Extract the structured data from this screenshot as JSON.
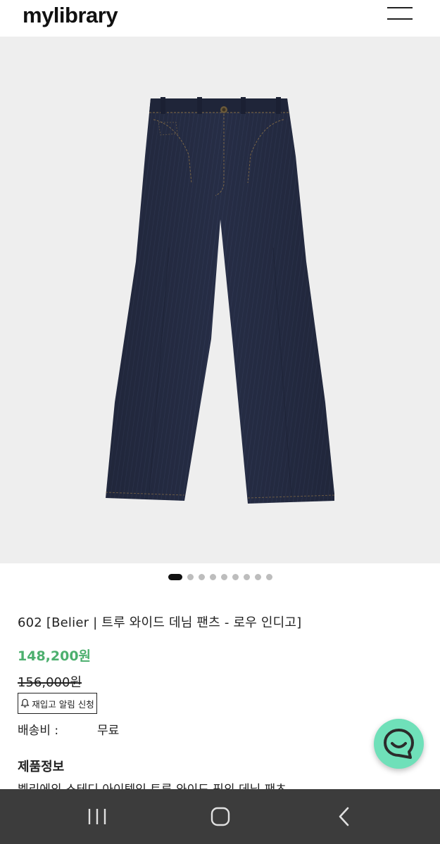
{
  "header": {
    "logo": "mylibrary",
    "menu_icon": "hamburger-menu-icon"
  },
  "gallery": {
    "total_images": 9,
    "active_index": 0,
    "product_image": "dark-indigo-wide-leg-jeans"
  },
  "product": {
    "title": "602 [Belier | 트루 와이드 데님 팬츠 - 로우 인디고]",
    "price": "148,200원",
    "original_price": "156,000원",
    "restock_button_label": "재입고 알림 신청",
    "shipping_label": "배송비 :",
    "shipping_value": "무료",
    "info_heading": "제품정보",
    "info_text": "벨리에의 스테디 아이템인 트루 와이드 핏의 데님 팬츠"
  },
  "colors": {
    "price_green": "#4caf6e",
    "chat_button": "#6fe0b9",
    "nav_bar": "#3c3c3c",
    "denim": "#262d45"
  },
  "chat": {
    "icon": "chat-bubble-smile-icon"
  },
  "system_nav": {
    "recent_icon": "recent-apps-icon",
    "home_icon": "home-icon",
    "back_icon": "back-icon"
  }
}
